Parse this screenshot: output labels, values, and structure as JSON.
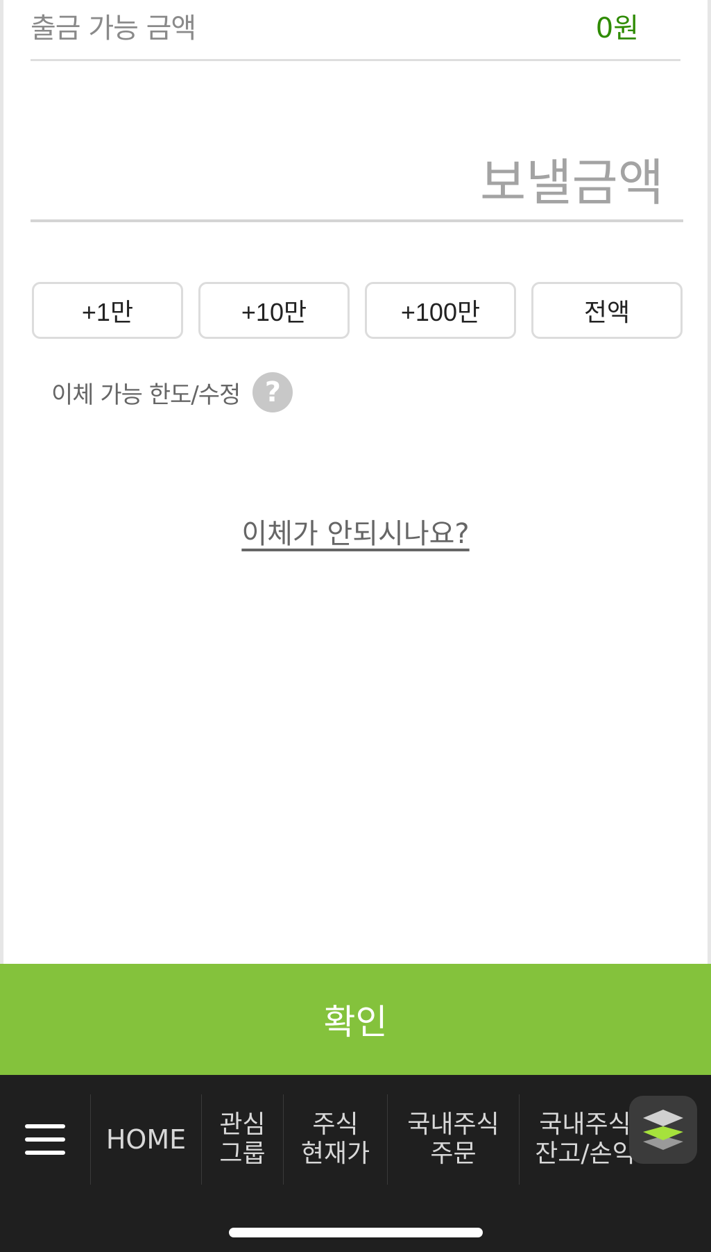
{
  "available": {
    "label": "출금 가능 금액",
    "value": "0원"
  },
  "amount_input": {
    "placeholder": "보낼금액",
    "value": ""
  },
  "quick_buttons": [
    "+1만",
    "+10만",
    "+100만",
    "전액"
  ],
  "limit": {
    "label": "이체 가능 한도/수정",
    "help_symbol": "?"
  },
  "trouble_link": "이체가 안되시나요?",
  "confirm_button": "확인",
  "bottom_nav": {
    "items": [
      "HOME",
      "관심\n그룹",
      "주식\n현재가",
      "국내주식\n주문",
      "국내주식\n잔고/손익"
    ]
  },
  "colors": {
    "accent": "#84c23c",
    "value_green": "#2e8b00",
    "nav_bg": "#1f1f1f",
    "layers_green": "#a6e23c"
  }
}
